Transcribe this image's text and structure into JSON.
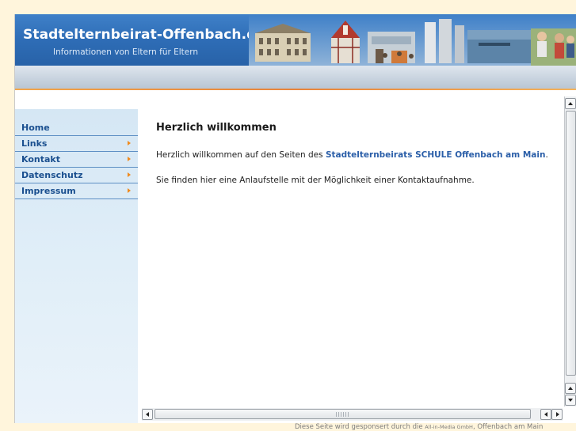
{
  "header": {
    "title": "Stadtelternbeirat-Offenbach.de",
    "subtitle": "Informationen von Eltern für Eltern"
  },
  "nav": {
    "items": [
      {
        "label": "Home",
        "has_arrow": false
      },
      {
        "label": "Links",
        "has_arrow": true
      },
      {
        "label": "Kontakt",
        "has_arrow": true
      },
      {
        "label": "Datenschutz",
        "has_arrow": true
      },
      {
        "label": "Impressum",
        "has_arrow": true
      }
    ]
  },
  "main": {
    "heading": "Herzlich willkommen",
    "para1_before": "Herzlich willkommen auf den Seiten des ",
    "para1_link": "Stadtelternbeirats SCHULE Offenbach am Main",
    "para1_after": ".",
    "para2": "Sie finden hier eine Anlaufstelle mit der Möglichkeit einer Kontaktaufnahme."
  },
  "footer": {
    "prefix": "Diese Seite wird gesponsert durch die ",
    "sponsor": "All-in-Media GmbH",
    "suffix": ", Offenbach am Main"
  },
  "colors": {
    "header_blue": "#2e6db6",
    "nav_text": "#1a4f8f",
    "arrow_orange": "#f08a1c",
    "link_blue": "#2a5ea8",
    "page_bg": "#fff5dc"
  }
}
